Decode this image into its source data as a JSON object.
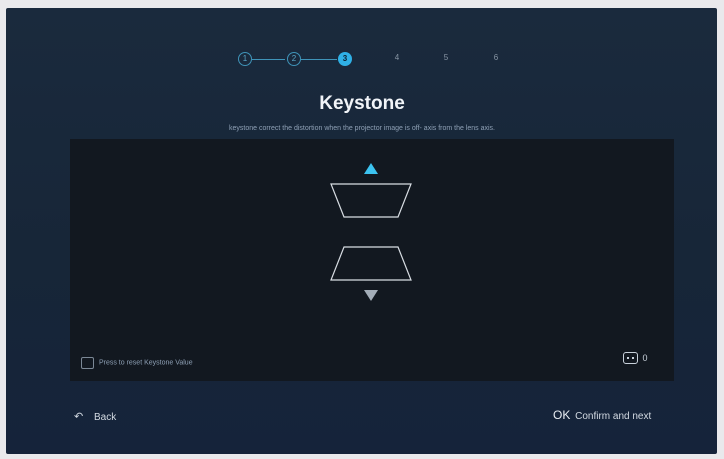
{
  "steps": [
    {
      "label": "1",
      "state": "done"
    },
    {
      "label": "2",
      "state": "done"
    },
    {
      "label": "3",
      "state": "active"
    },
    {
      "label": "4",
      "state": "todo"
    },
    {
      "label": "5",
      "state": "todo"
    },
    {
      "label": "6",
      "state": "todo"
    }
  ],
  "title": "Keystone",
  "subtitle": "keystone correct the distortion when the projector image is off- axis from the lens axis.",
  "panel": {
    "up_icon": "triangle-up-icon",
    "down_icon": "triangle-down-icon",
    "reset_label": "Press to reset Keystone Value",
    "keystone_value": "0"
  },
  "footer": {
    "back_label": "Back",
    "ok_key": "OK",
    "confirm_label": "Confirm and next"
  },
  "colors": {
    "accent": "#2fb0e6",
    "background": "#172638",
    "panel": "#121820"
  }
}
